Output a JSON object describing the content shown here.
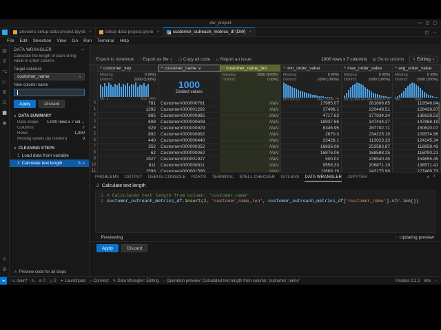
{
  "title_bar": {
    "title": "dw_project",
    "icons": [
      "toggle-panel-icon",
      "toggle-sidebar-icon",
      "customize-layout-icon"
    ]
  },
  "tabs": [
    {
      "label": "answers-setup-data-project.ipynb",
      "icon": "notebook-icon",
      "active": false
    },
    {
      "label": "setup-data-project.ipynb",
      "icon": "notebook-icon",
      "active": false
    },
    {
      "label": "customer_outreach_metrics_df [DW]",
      "icon": "data-wrangler-icon",
      "active": true
    }
  ],
  "menu_bar": {
    "items": [
      "File",
      "Edit",
      "Selection",
      "View",
      "Go",
      "Run",
      "Terminal",
      "Help"
    ]
  },
  "activity_bar": {
    "top": [
      {
        "name": "files-icon"
      },
      {
        "name": "search-icon"
      },
      {
        "name": "source-control-icon"
      },
      {
        "name": "run-debug-icon"
      },
      {
        "name": "extensions-icon"
      },
      {
        "name": "remote-explorer-icon"
      },
      {
        "name": "data-wrangler-icon",
        "active": true
      },
      {
        "name": "jupyter-icon"
      }
    ],
    "bottom": [
      {
        "name": "account-icon"
      },
      {
        "name": "settings-icon"
      }
    ]
  },
  "sidebar": {
    "title": "DATA WRANGLER",
    "operations": {
      "description": "Calculate the length of each string value in a text column.",
      "target_label": "Target columns",
      "target_value": "customer_name",
      "new_col_label": "New column name",
      "new_col_value": "",
      "apply_label": "Apply",
      "discard_label": "Discard"
    },
    "data_summary": {
      "section": "DATA SUMMARY",
      "rows": [
        {
          "label": "Data shape",
          "value": "1,000 rows x 7 columns"
        },
        {
          "label": "Columns",
          "value": "7"
        },
        {
          "label": "Rows",
          "value": "1,000"
        },
        {
          "label": "Missing values (by column)",
          "value": "0"
        }
      ]
    },
    "cleaning_steps": {
      "section": "CLEANING STEPS",
      "steps": [
        {
          "num": "1",
          "label": "Load data from variable",
          "active": false
        },
        {
          "num": "2",
          "label": "Calculate text length",
          "active": true
        }
      ]
    },
    "footer": "Preview code for all steps"
  },
  "toolbar": {
    "items": [
      {
        "icon": "export-icon",
        "label": "Export to notebook"
      },
      {
        "icon": "export-icon",
        "label": "Export as file",
        "chevron": true
      },
      {
        "icon": "copy-icon",
        "label": "Copy all code"
      },
      {
        "icon": "issue-icon",
        "label": "Report an issue"
      }
    ],
    "shape": "1000 rows x 7 columns",
    "goto": "Go to column",
    "mode": "Editing"
  },
  "grid": {
    "labels": {
      "missing": "Missing:",
      "distinct": "Distinct:"
    },
    "columns": [
      {
        "name": "customer_key",
        "type": "numeric",
        "missing": "0 (0%)",
        "distinct": "1000 (100%)",
        "min": "Min 1",
        "max": "Max 1499",
        "hist": [
          0.82,
          0.66,
          0.9,
          0.74,
          0.95,
          0.8,
          0.7,
          0.88,
          0.78,
          0.92,
          0.68,
          0.85,
          0.76,
          0.9,
          0.72,
          0.86,
          0.8,
          0.94,
          0.7,
          0.84,
          0.77,
          0.9,
          0.73,
          0.87
        ]
      },
      {
        "name": "customer_name",
        "type": "text",
        "selected": true,
        "distinct_big": "1000",
        "distinct_caption": "Distinct values"
      },
      {
        "name": "customer_name_len",
        "type": "numeric",
        "new": true,
        "missing": "1000 (100%)",
        "distinct": "0 (0%)",
        "min": "",
        "max": ""
      },
      {
        "name": "min_order_value",
        "type": "numeric",
        "missing": "0 (0%)",
        "distinct": "1000 (100%)",
        "min": "Min 500.02",
        "max": "Max 66836.78",
        "hist": [
          1,
          0.92,
          0.84,
          0.77,
          0.7,
          0.63,
          0.57,
          0.51,
          0.45,
          0.4,
          0.35,
          0.3,
          0.26,
          0.22,
          0.19,
          0.16,
          0.13,
          0.11,
          0.09,
          0.07,
          0.06,
          0.05,
          0.04,
          0.03
        ]
      },
      {
        "name": "max_order_value",
        "type": "numeric",
        "missing": "0 (0%)",
        "distinct": "1000 (100%)",
        "min": "Min 52263.04",
        "max": "Max 460018.35",
        "hist": [
          0.15,
          0.3,
          0.5,
          0.68,
          0.82,
          0.93,
          1,
          0.97,
          0.9,
          0.8,
          0.7,
          0.6,
          0.5,
          0.42,
          0.34,
          0.27,
          0.21,
          0.16,
          0.12,
          0.09,
          0.07,
          0.05,
          0.04,
          0.03
        ]
      },
      {
        "name": "avg_order_value",
        "type": "numeric",
        "missing": "0 (0%)",
        "distinct": "1000 (100%)",
        "min": "Min 26156.86",
        "max": "Max 165054.45",
        "hist": [
          0.05,
          0.1,
          0.18,
          0.3,
          0.45,
          0.62,
          0.78,
          0.9,
          1,
          0.96,
          0.88,
          0.76,
          0.62,
          0.48,
          0.36,
          0.26,
          0.18,
          0.12,
          0.08,
          0.05,
          0.03,
          0.02,
          0.02,
          0.01
        ]
      }
    ],
    "rows": [
      [
        "0",
        "781",
        "Customer#000000781",
        "NaN",
        "17995.07",
        "281806.65",
        "119548.84"
      ],
      [
        "1",
        "1292",
        "Customer#000001292",
        "NaN",
        "37496.1",
        "220449.51",
        "128428.87"
      ],
      [
        "2",
        "885",
        "Customer#000000885",
        "NaN",
        "4717.63",
        "177934.34",
        "136628.52"
      ],
      [
        "3",
        "608",
        "Customer#000000608",
        "NaN",
        "18937.66",
        "147444.27",
        "147868.19"
      ],
      [
        "4",
        "929",
        "Customer#000000929",
        "NaN",
        "8346.95",
        "287702.71",
        "150620.07"
      ],
      [
        "5",
        "892",
        "Customer#000000892",
        "NaN",
        "2670.3",
        "234225.19",
        "109574.96"
      ],
      [
        "6",
        "440",
        "Customer#000000440",
        "NaN",
        "23428.1",
        "113023.33",
        "124145.34"
      ],
      [
        "7",
        "352",
        "Customer#000000352",
        "NaN",
        "16836.06",
        "253583.87",
        "118858.43"
      ],
      [
        "8",
        "62",
        "Customer#000000062",
        "NaN",
        "16876.06",
        "168588.25",
        "116090.21"
      ],
      [
        "9",
        "1927",
        "Customer#000001927",
        "NaN",
        "500.02",
        "226540.45",
        "154655.45"
      ],
      [
        "10",
        "811",
        "Customer#000000811",
        "NaN",
        "9558.33",
        "206871.19",
        "138571.41"
      ],
      [
        "11",
        "1598",
        "Customer#000001598",
        "NaN",
        "11668.19",
        "243175.98",
        "127468.73"
      ]
    ]
  },
  "panel": {
    "tabs": [
      "PROBLEMS",
      "OUTPUT",
      "DEBUG CONSOLE",
      "PORTS",
      "TERMINAL",
      "SPELL CHECKER",
      "GITLENS",
      "DATA WRANGLER",
      "JUPYTER"
    ],
    "active_tab": "DATA WRANGLER",
    "step_num": "2",
    "step_title": "Calculate text length",
    "code": [
      {
        "num": "1",
        "tokens": [
          {
            "t": "comment",
            "s": "# Calculated text length from column: 'customer_name'"
          }
        ]
      },
      {
        "num": "2",
        "tokens": [
          {
            "t": "var",
            "s": "customer_outreach_metrics_df"
          },
          {
            "t": "plain",
            "s": "."
          },
          {
            "t": "fn",
            "s": "insert"
          },
          {
            "t": "plain",
            "s": "("
          },
          {
            "t": "num",
            "s": "2"
          },
          {
            "t": "plain",
            "s": ", "
          },
          {
            "t": "str",
            "s": "'customer_name_len'"
          },
          {
            "t": "plain",
            "s": ", "
          },
          {
            "t": "var",
            "s": "customer_outreach_metrics_df"
          },
          {
            "t": "plain",
            "s": "["
          },
          {
            "t": "str",
            "s": "'customer_name'"
          },
          {
            "t": "plain",
            "s": "]."
          },
          {
            "t": "var",
            "s": "str"
          },
          {
            "t": "plain",
            "s": "."
          },
          {
            "t": "fn",
            "s": "len"
          },
          {
            "t": "plain",
            "s": "())"
          }
        ]
      }
    ],
    "previewing": "Previewing",
    "updating": "Updating preview",
    "apply": "Apply",
    "discard": "Discard"
  },
  "status_bar": {
    "left": [
      {
        "icon": "remote-icon",
        "label": "",
        "kind": "remote"
      },
      {
        "icon": "branch-icon",
        "label": "main*"
      },
      {
        "icon": "sync-icon",
        "label": ""
      },
      {
        "icon": "error-icon",
        "label": "0"
      },
      {
        "icon": "warning-icon",
        "label": "2"
      },
      {
        "icon": "launchpad-icon",
        "label": "Launchpad"
      },
      {
        "icon": "connect-icon",
        "label": "Connect"
      },
      {
        "icon": "edit-icon",
        "label": "Data Wrangler: Editing"
      },
      {
        "icon": "spinner-icon",
        "label": "Operation preview: Calculated text length from column: 'customer_name'"
      }
    ],
    "right": [
      {
        "label": "Pandas 2.2.3"
      },
      {
        "label": "Idle"
      },
      {
        "icon": "bell-icon",
        "label": ""
      }
    ]
  }
}
